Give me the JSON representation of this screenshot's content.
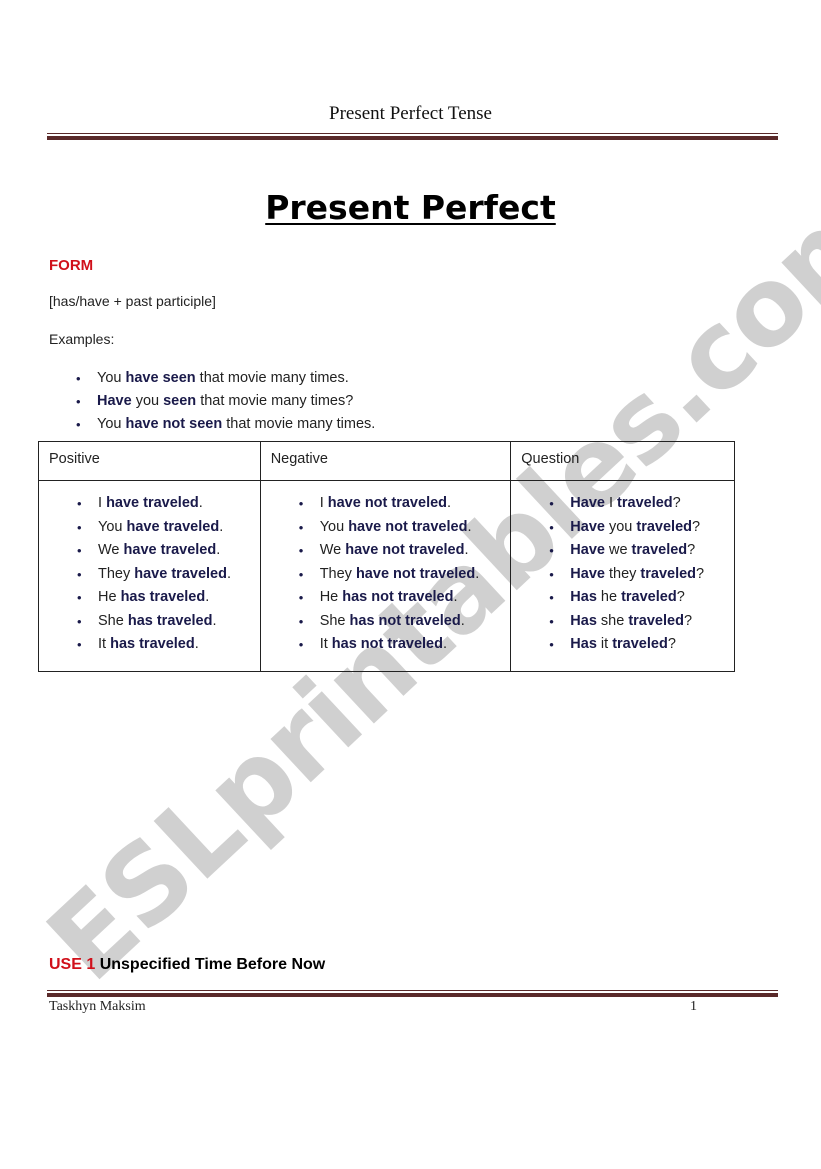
{
  "header": {
    "title": "Present Perfect Tense"
  },
  "document": {
    "title": "Present Perfect",
    "form_label": "FORM",
    "formula": "[has/have + past participle]",
    "examples_label": "Examples:",
    "examples": [
      [
        {
          "t": "You ",
          "b": false
        },
        {
          "t": "have seen",
          "b": true
        },
        {
          "t": " that movie many times.",
          "b": false
        }
      ],
      [
        {
          "t": "Have",
          "b": true
        },
        {
          "t": " you ",
          "b": false
        },
        {
          "t": "seen",
          "b": true
        },
        {
          "t": " that movie many times?",
          "b": false
        }
      ],
      [
        {
          "t": "You ",
          "b": false
        },
        {
          "t": "have not seen",
          "b": true
        },
        {
          "t": " that movie many times.",
          "b": false
        }
      ]
    ],
    "table": {
      "headers": [
        "Positive",
        "Negative",
        "Question"
      ],
      "columns": [
        [
          [
            {
              "t": "I ",
              "b": false
            },
            {
              "t": "have traveled",
              "b": true
            },
            {
              "t": ".",
              "b": false
            }
          ],
          [
            {
              "t": "You ",
              "b": false
            },
            {
              "t": "have traveled",
              "b": true
            },
            {
              "t": ".",
              "b": false
            }
          ],
          [
            {
              "t": "We ",
              "b": false
            },
            {
              "t": "have traveled",
              "b": true
            },
            {
              "t": ".",
              "b": false
            }
          ],
          [
            {
              "t": "They ",
              "b": false
            },
            {
              "t": "have traveled",
              "b": true
            },
            {
              "t": ".",
              "b": false
            }
          ],
          [
            {
              "t": "He ",
              "b": false
            },
            {
              "t": "has traveled",
              "b": true
            },
            {
              "t": ".",
              "b": false
            }
          ],
          [
            {
              "t": "She ",
              "b": false
            },
            {
              "t": "has traveled",
              "b": true
            },
            {
              "t": ".",
              "b": false
            }
          ],
          [
            {
              "t": "It ",
              "b": false
            },
            {
              "t": "has traveled",
              "b": true
            },
            {
              "t": ".",
              "b": false
            }
          ]
        ],
        [
          [
            {
              "t": "I ",
              "b": false
            },
            {
              "t": "have not traveled",
              "b": true
            },
            {
              "t": ".",
              "b": false
            }
          ],
          [
            {
              "t": "You ",
              "b": false
            },
            {
              "t": "have not traveled",
              "b": true
            },
            {
              "t": ".",
              "b": false
            }
          ],
          [
            {
              "t": "We ",
              "b": false
            },
            {
              "t": "have not traveled",
              "b": true
            },
            {
              "t": ".",
              "b": false
            }
          ],
          [
            {
              "t": "They ",
              "b": false
            },
            {
              "t": "have not traveled",
              "b": true
            },
            {
              "t": ".",
              "b": false
            }
          ],
          [
            {
              "t": "He ",
              "b": false
            },
            {
              "t": "has not traveled",
              "b": true
            },
            {
              "t": ".",
              "b": false
            }
          ],
          [
            {
              "t": "She ",
              "b": false
            },
            {
              "t": "has not traveled",
              "b": true
            },
            {
              "t": ".",
              "b": false
            }
          ],
          [
            {
              "t": "It ",
              "b": false
            },
            {
              "t": "has not traveled",
              "b": true
            },
            {
              "t": ".",
              "b": false
            }
          ]
        ],
        [
          [
            {
              "t": "Have",
              "b": true
            },
            {
              "t": " I ",
              "b": false
            },
            {
              "t": "traveled",
              "b": true
            },
            {
              "t": "?",
              "b": false
            }
          ],
          [
            {
              "t": "Have",
              "b": true
            },
            {
              "t": " you ",
              "b": false
            },
            {
              "t": "traveled",
              "b": true
            },
            {
              "t": "?",
              "b": false
            }
          ],
          [
            {
              "t": "Have",
              "b": true
            },
            {
              "t": " we ",
              "b": false
            },
            {
              "t": "traveled",
              "b": true
            },
            {
              "t": "?",
              "b": false
            }
          ],
          [
            {
              "t": "Have",
              "b": true
            },
            {
              "t": " they ",
              "b": false
            },
            {
              "t": "traveled",
              "b": true
            },
            {
              "t": "?",
              "b": false
            }
          ],
          [
            {
              "t": "Has",
              "b": true
            },
            {
              "t": " he ",
              "b": false
            },
            {
              "t": "traveled",
              "b": true
            },
            {
              "t": "?",
              "b": false
            }
          ],
          [
            {
              "t": "Has",
              "b": true
            },
            {
              "t": " she ",
              "b": false
            },
            {
              "t": "traveled",
              "b": true
            },
            {
              "t": "?",
              "b": false
            }
          ],
          [
            {
              "t": "Has",
              "b": true
            },
            {
              "t": " it ",
              "b": false
            },
            {
              "t": "traveled",
              "b": true
            },
            {
              "t": "?",
              "b": false
            }
          ]
        ]
      ]
    },
    "use_heading": {
      "number": "USE 1",
      "text": "Unspecified Time Before Now"
    }
  },
  "footer": {
    "author": "Taskhyn Maksim",
    "page_number": "1"
  },
  "watermark": {
    "text": "ESLprintables.com"
  },
  "colors": {
    "accent_red": "#d0101a",
    "keyword_navy": "#1a1a4a",
    "rule_maroon": "#5a2a2a"
  }
}
